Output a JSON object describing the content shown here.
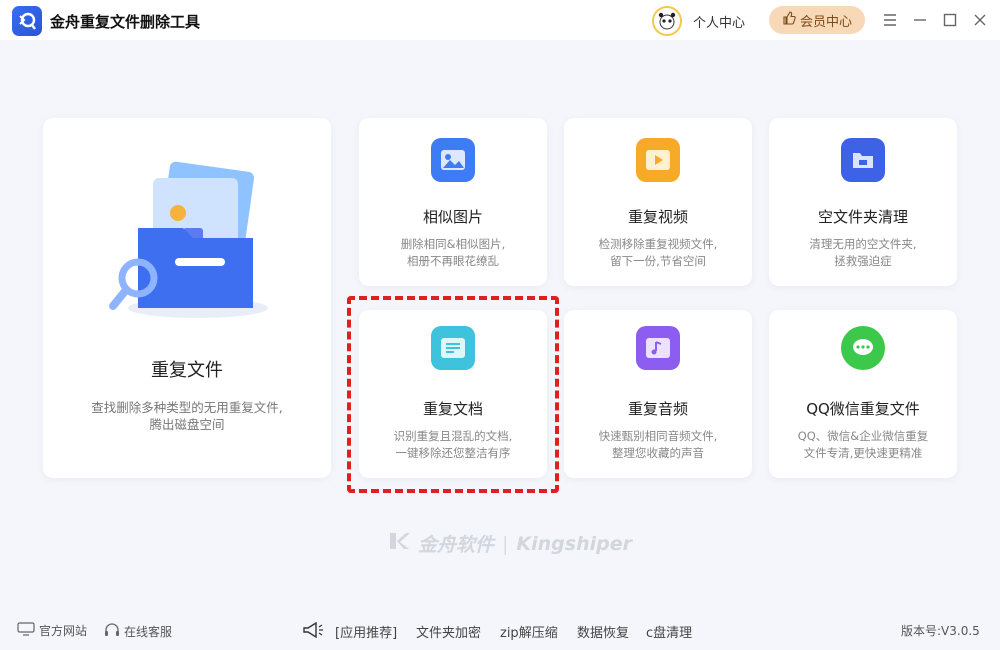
{
  "window": {
    "title": "金舟重复文件删除工具",
    "user_center": "个人中心",
    "vip_center": "会员中心",
    "controls": [
      "menu-icon",
      "minimize-icon",
      "maximize-icon",
      "close-icon"
    ]
  },
  "main_card": {
    "title": "重复文件",
    "desc_line1": "查找删除多种类型的无用重复文件,",
    "desc_line2": "腾出磁盘空间"
  },
  "cards": [
    {
      "id": "similar-images",
      "title": "相似图片",
      "desc_line1": "删除相同&相似图片,",
      "desc_line2": "相册不再眼花缭乱",
      "icon": "image-icon",
      "color": "#3d7cf5"
    },
    {
      "id": "duplicate-video",
      "title": "重复视频",
      "desc_line1": "检测移除重复视频文件,",
      "desc_line2": "留下一份,节省空间",
      "icon": "video-icon",
      "color": "#f7a928"
    },
    {
      "id": "empty-folder",
      "title": "空文件夹清理",
      "desc_line1": "清理无用的空文件夹,",
      "desc_line2": "拯救强迫症",
      "icon": "folder-icon",
      "color": "#3d62e6"
    },
    {
      "id": "duplicate-docs",
      "title": "重复文档",
      "desc_line1": "识别重复且混乱的文档,",
      "desc_line2": "一键移除还您整洁有序",
      "icon": "document-icon",
      "color": "#3fc3dc"
    },
    {
      "id": "duplicate-audio",
      "title": "重复音频",
      "desc_line1": "快速甄别相同音频文件,",
      "desc_line2": "整理您收藏的声音",
      "icon": "music-icon",
      "color": "#8d5cf0"
    },
    {
      "id": "qq-wechat",
      "title": "QQ微信重复文件",
      "desc_line1": "QQ、微信&企业微信重复",
      "desc_line2": "文件专清,更快速更精准",
      "icon": "wechat-icon",
      "color": "#3cc84a"
    }
  ],
  "watermark": {
    "brand_cn": "金舟软件",
    "brand_en": "Kingshiper"
  },
  "footer": {
    "official_site": "官方网站",
    "online_service": "在线客服",
    "links": [
      "[应用推荐]",
      "文件夹加密",
      "zip解压缩",
      "数据恢复",
      "c盘清理"
    ],
    "version": "版本号:V3.0.5"
  },
  "colors": {
    "accent": "#3d7cf5",
    "highlight": "#e02020",
    "vip_bg": "#f7d9b8"
  }
}
